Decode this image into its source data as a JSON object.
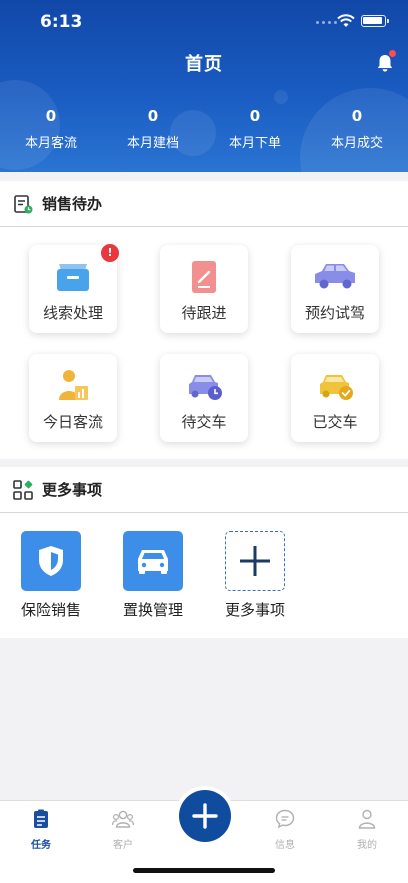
{
  "status_bar": {
    "time": "6:13"
  },
  "header": {
    "title": "首页"
  },
  "stats": [
    {
      "value": "0",
      "label": "本月客流"
    },
    {
      "value": "0",
      "label": "本月建档"
    },
    {
      "value": "0",
      "label": "本月下单"
    },
    {
      "value": "0",
      "label": "本月成交"
    }
  ],
  "sales_todo": {
    "title": "销售待办",
    "items": [
      {
        "label": "线索处理",
        "icon": "folder-icon",
        "badge": "!"
      },
      {
        "label": "待跟进",
        "icon": "edit-note-icon"
      },
      {
        "label": "预约试驾",
        "icon": "car-side-icon"
      },
      {
        "label": "今日客流",
        "icon": "person-chart-icon"
      },
      {
        "label": "待交车",
        "icon": "car-clock-icon"
      },
      {
        "label": "已交车",
        "icon": "car-check-icon"
      }
    ]
  },
  "more": {
    "title": "更多事项",
    "items": [
      {
        "label": "保险销售",
        "icon": "shield-icon"
      },
      {
        "label": "置换管理",
        "icon": "car-front-icon"
      },
      {
        "label": "更多事项",
        "icon": "plus-icon"
      }
    ]
  },
  "tabbar": {
    "items": [
      {
        "label": "任务",
        "active": true
      },
      {
        "label": "客户"
      },
      {
        "label": "信息"
      },
      {
        "label": "我的"
      }
    ]
  },
  "colors": {
    "brand_blue": "#1a5cc2",
    "accent_blue": "#3d8ee8",
    "badge_red": "#e8383d"
  }
}
